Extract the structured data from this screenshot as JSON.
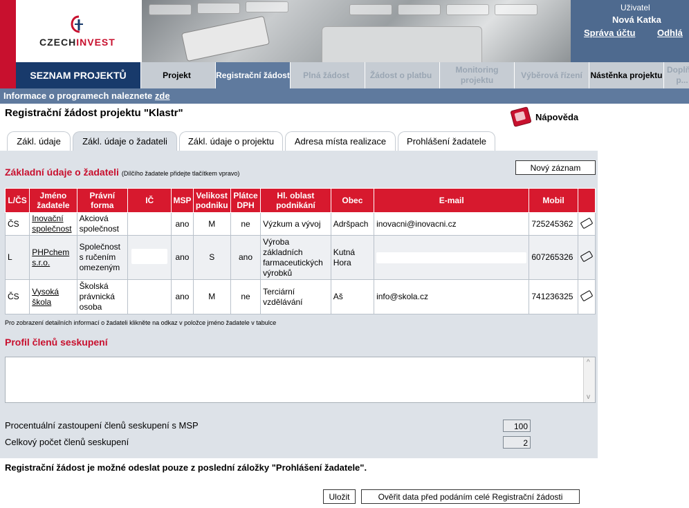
{
  "header": {
    "logo_text_a": "CZECH",
    "logo_text_b": "INVEST",
    "user_label": "Uživatel",
    "user_name": "Nová Katka",
    "account_link": "Správa účtu",
    "logout_link": "Odhlá"
  },
  "nav": {
    "brand": "SEZNAM PROJEKTŮ",
    "items": [
      {
        "label": "Projekt",
        "state": "enabled"
      },
      {
        "label": "Registrační žádost",
        "state": "active"
      },
      {
        "label": "Plná žádost",
        "state": "disabled"
      },
      {
        "label": "Žádost o platbu",
        "state": "disabled"
      },
      {
        "label": "Monitoring projektu",
        "state": "disabled"
      },
      {
        "label": "Výběrová řízení",
        "state": "disabled"
      },
      {
        "label": "Nástěnka projektu",
        "state": "enabled"
      },
      {
        "label": "Doplň... p...",
        "state": "disabled"
      }
    ]
  },
  "infobar": {
    "text": "Informace o programech naleznete ",
    "link": "zde"
  },
  "page_title": "Registrační žádost projektu   \"Klastr\"",
  "help_label": "Nápověda",
  "tabs": [
    "Zákl. údaje",
    "Zákl. údaje o žadateli",
    "Zákl. údaje o projektu",
    "Adresa místa realizace",
    "Prohlášení žadatele"
  ],
  "active_tab": 1,
  "section": {
    "title": "Základní údaje o žadateli",
    "subtitle": "(Dílčího žadatele přidejte tlačítkem vpravo)",
    "new_record_button": "Nový záznam"
  },
  "table": {
    "columns": [
      "L/ČS",
      "Jméno žadatele",
      "Právní forma",
      "IČ",
      "MSP",
      "Velikost podniku",
      "Plátce DPH",
      "Hl. oblast podnikání",
      "Obec",
      "E-mail",
      "Mobil",
      ""
    ],
    "rows": [
      {
        "lcs": "ČS",
        "name": "Inovační společnost",
        "form": "Akciová společnost",
        "msp": "ano",
        "size": "M",
        "vat": "ne",
        "area": "Výzkum a vývoj",
        "city": "Adršpach",
        "email": "inovacni@inovacni.cz",
        "mobile": "725245362"
      },
      {
        "lcs": "L",
        "name": "PHPchem s.r.o.",
        "form": "Společnost s ručením omezeným",
        "msp": "ano",
        "size": "S",
        "vat": "ano",
        "area": "Výroba základních farmaceutických výrobků",
        "city": "Kutná Hora",
        "email": "",
        "mobile": "607265326"
      },
      {
        "lcs": "ČS",
        "name": "Vysoká škola",
        "form": "Školská právnická osoba",
        "msp": "ano",
        "size": "M",
        "vat": "ne",
        "area": "Terciární vzdělávání",
        "city": "Aš",
        "email": "info@skola.cz",
        "mobile": "741236325"
      }
    ]
  },
  "table_note": "Pro zobrazení detailních informací o žadateli klikněte na odkaz v položce jméno žadatele v tabulce",
  "profile": {
    "title": "Profil členů seskupení",
    "value": ""
  },
  "stats": {
    "msp_pct_label": "Procentuální zastoupení členů seskupení s MSP",
    "msp_pct_value": "100",
    "members_label": "Celkový počet členů seskupení",
    "members_value": "2"
  },
  "warning": "Registrační žádost je možné odeslat pouze z poslední záložky \"Prohlášení žadatele\".",
  "buttons": {
    "save": "Uložit",
    "verify": "Ověřit data před podáním celé Registrační žádosti"
  },
  "colors": {
    "brand_red": "#c8102e",
    "navy": "#183a6b",
    "panel": "#dde2e8",
    "infobar": "#5f7a9e"
  }
}
